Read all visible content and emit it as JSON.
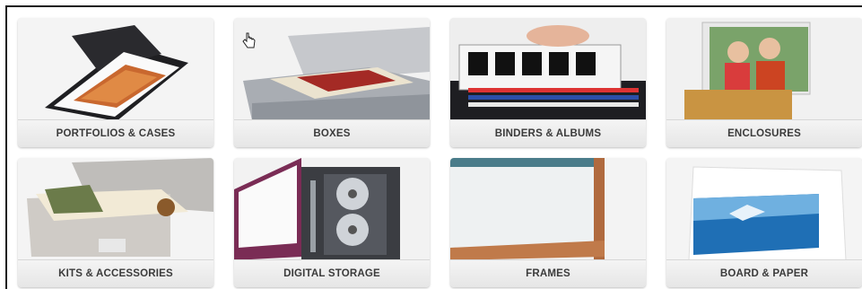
{
  "categories": [
    {
      "label": "PORTFOLIOS & CASES",
      "icon": "portfolio-case-image"
    },
    {
      "label": "BOXES",
      "icon": "archival-box-image"
    },
    {
      "label": "BINDERS & ALBUMS",
      "icon": "binder-image"
    },
    {
      "label": "ENCLOSURES",
      "icon": "photo-enclosure-image"
    },
    {
      "label": "KITS & ACCESSORIES",
      "icon": "kit-box-image"
    },
    {
      "label": "DIGITAL STORAGE",
      "icon": "cd-binder-image"
    },
    {
      "label": "FRAMES",
      "icon": "frame-image"
    },
    {
      "label": "BOARD & PAPER",
      "icon": "board-paper-image"
    }
  ]
}
